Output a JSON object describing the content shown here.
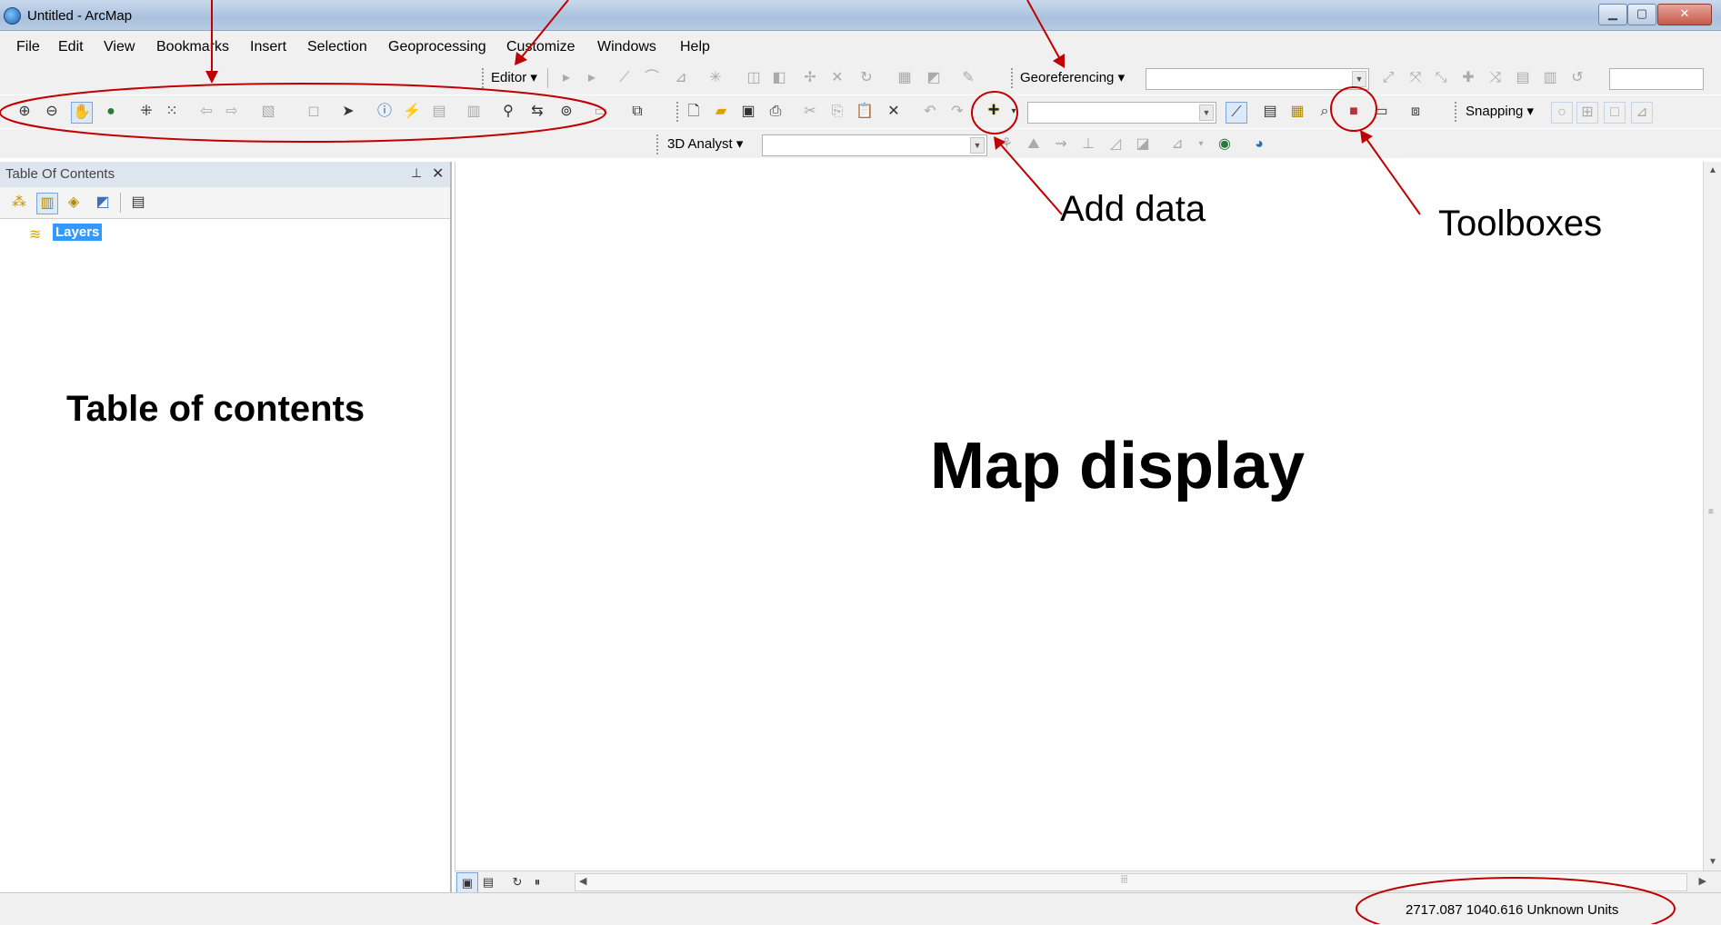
{
  "window": {
    "title": "Untitled - ArcMap",
    "controls": [
      "minimize",
      "maximize",
      "close"
    ]
  },
  "menu": [
    "File",
    "Edit",
    "View",
    "Bookmarks",
    "Insert",
    "Selection",
    "Geoprocessing",
    "Customize",
    "Windows",
    "Help"
  ],
  "toolbars": {
    "editor_label": "Editor ▾",
    "georeferencing_label": "Georeferencing ▾",
    "snapping_label": "Snapping ▾",
    "analyst_label": "3D Analyst ▾"
  },
  "toc": {
    "title": "Table Of Contents",
    "pin": "⫯",
    "close": "✕",
    "layers_label": "Layers"
  },
  "status": {
    "coordinates": "2717.087  1040.616 Unknown Units"
  },
  "annotations": {
    "add_data": "Add data",
    "toolboxes": "Toolboxes",
    "toc_label": "Table of contents",
    "map_label": "Map display"
  },
  "colors": {
    "annotation_red": "#c00000",
    "selection_blue": "#3399ff"
  }
}
